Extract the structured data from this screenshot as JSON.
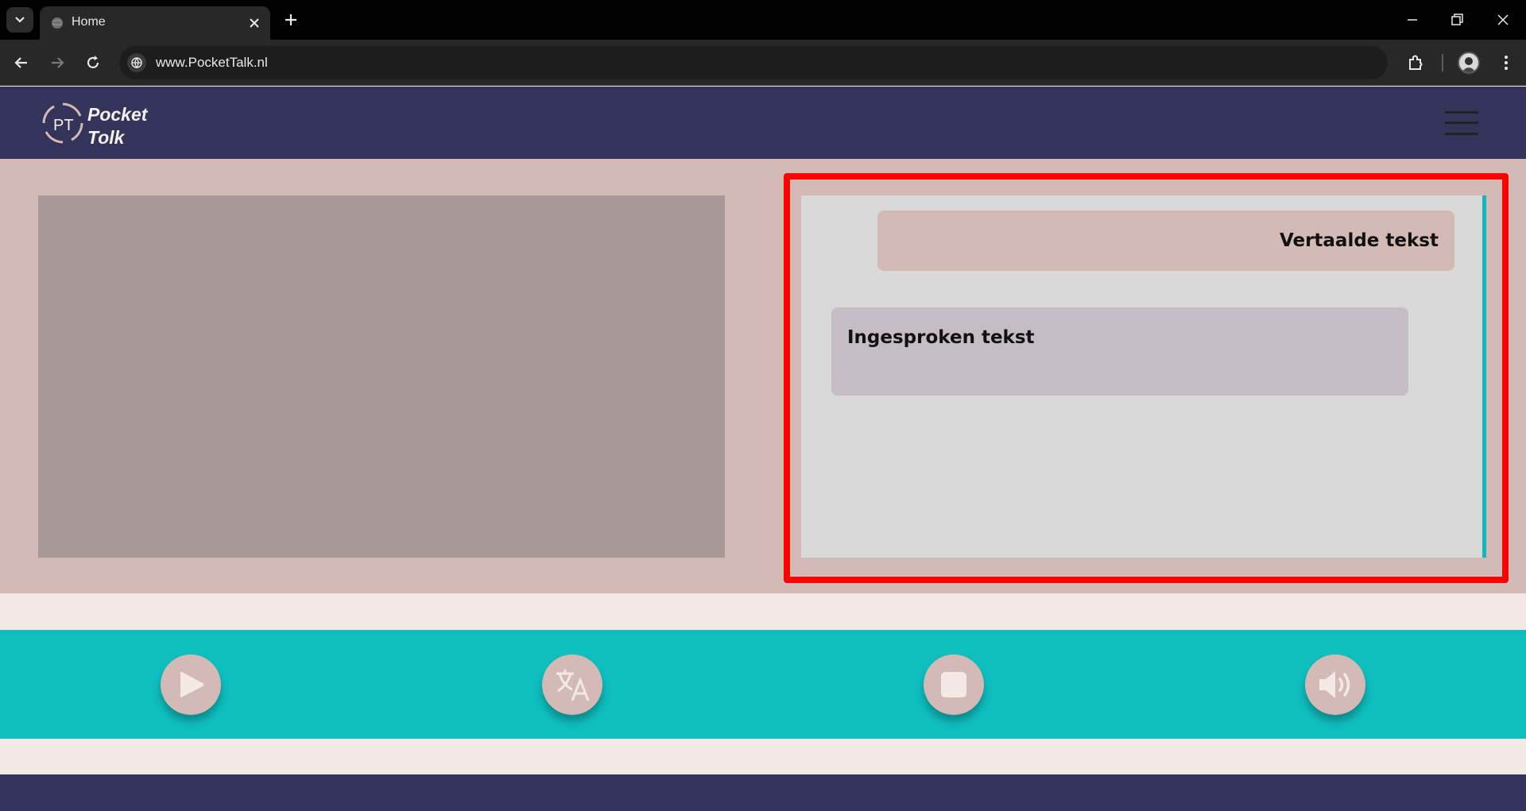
{
  "browser": {
    "tab_title": "Home",
    "url": "www.PocketTalk.nl"
  },
  "header": {
    "logo_line1": "Pocket",
    "logo_line2": "Tolk",
    "logo_monogram": "PT"
  },
  "chat": {
    "translated_text": "Vertaalde tekst",
    "spoken_text": "Ingesproken tekst"
  },
  "controls": {
    "icons": [
      "play-icon",
      "translate-icon",
      "stop-icon",
      "volume-icon"
    ]
  },
  "colors": {
    "header_bg": "#34335a",
    "main_bg": "#d3bab4",
    "controls_bg": "#0fbfc0",
    "highlight": "#ff0000"
  }
}
